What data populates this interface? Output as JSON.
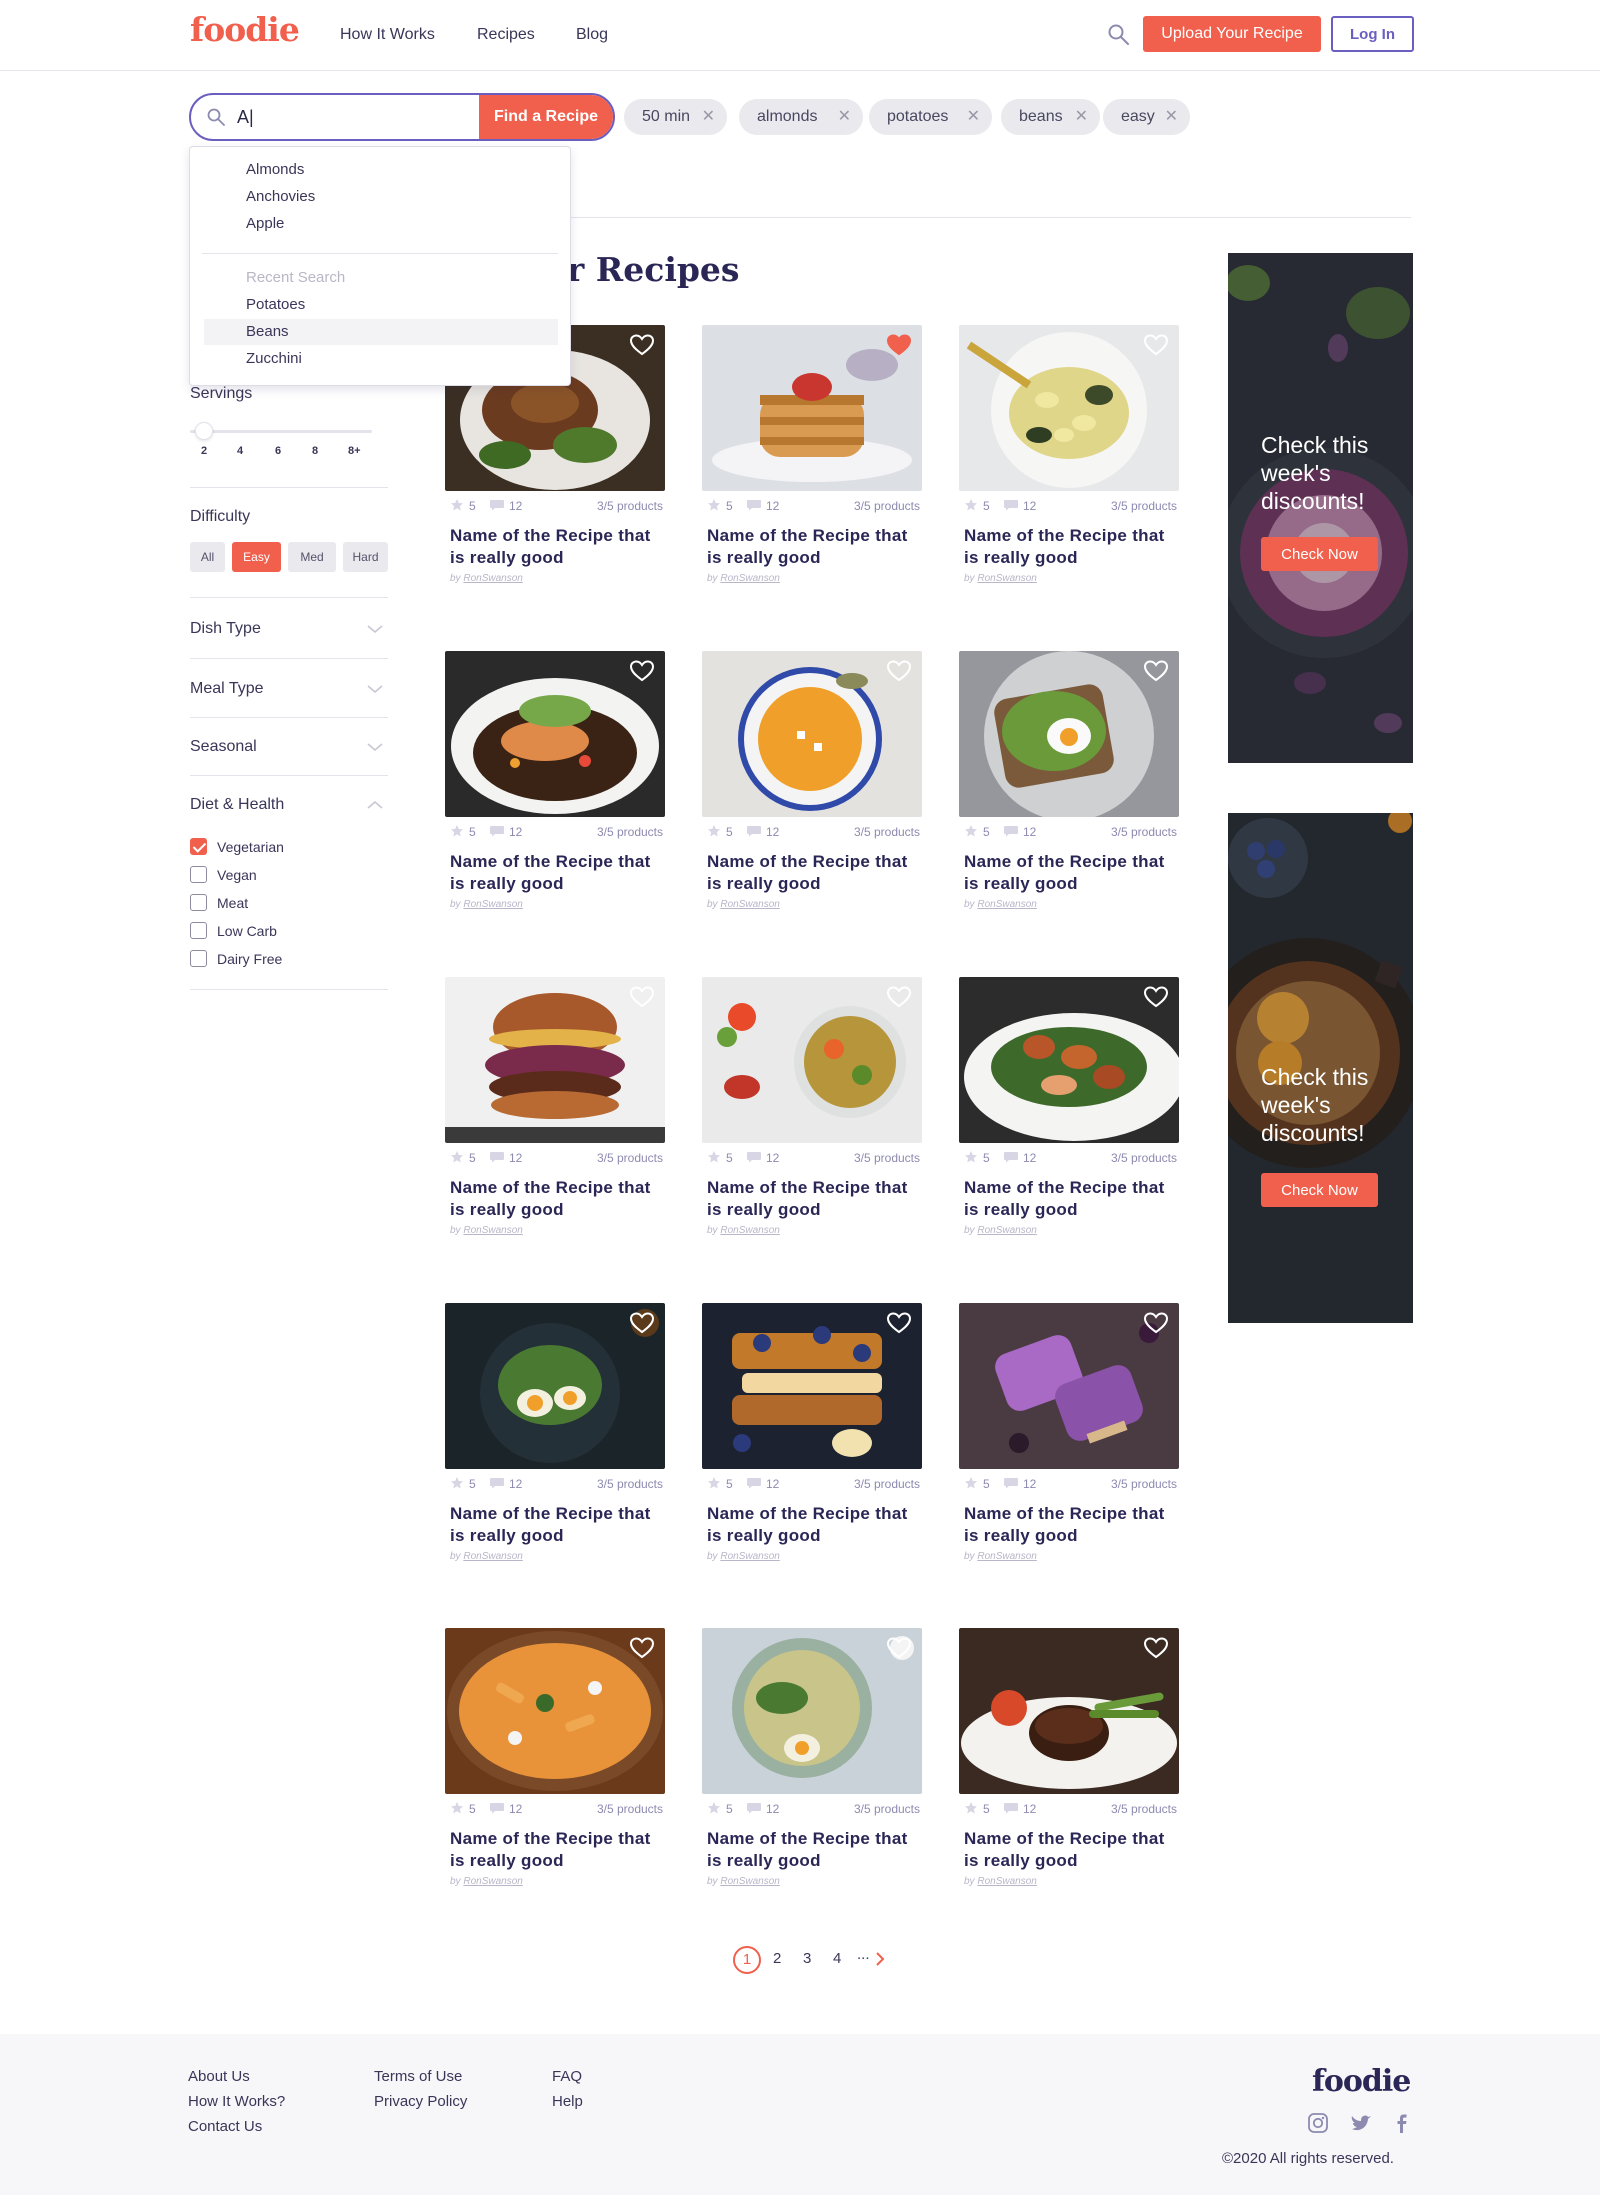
{
  "header": {
    "logo": "foodie",
    "nav": [
      "How It Works",
      "Recipes",
      "Blog"
    ],
    "upload_label": "Upload Your Recipe",
    "login_label": "Log In"
  },
  "search": {
    "value": "A|",
    "button_label": "Find a Recipe",
    "chips": [
      "50 min",
      "almonds",
      "potatoes",
      "beans",
      "easy"
    ]
  },
  "dropdown": {
    "suggestions": [
      "Almonds",
      "Anchovies",
      "Apple"
    ],
    "recent_label": "Recent Search",
    "recent": [
      "Potatoes",
      "Beans",
      "Zucchini"
    ]
  },
  "main": {
    "title": "Popular Recipes"
  },
  "sidebar": {
    "servings_label": "Servings",
    "servings_ticks": [
      "2",
      "4",
      "6",
      "8",
      "8+"
    ],
    "difficulty_label": "Difficulty",
    "difficulty": [
      "All",
      "Easy",
      "Med",
      "Hard"
    ],
    "difficulty_selected": "Easy",
    "accordions": [
      "Dish Type",
      "Meal Type",
      "Seasonal",
      "Diet & Health"
    ],
    "diet_options": [
      {
        "label": "Vegetarian",
        "checked": true
      },
      {
        "label": "Vegan",
        "checked": false
      },
      {
        "label": "Meat",
        "checked": false
      },
      {
        "label": "Low Carb",
        "checked": false
      },
      {
        "label": "Dairy Free",
        "checked": false
      }
    ]
  },
  "card_template": {
    "rating": "5",
    "comments": "12",
    "products": "3/5 products",
    "title": "Name of the Recipe that is really good",
    "by": "by",
    "author": "RonSwanson"
  },
  "recipes": [
    {
      "img": "grilled-meat",
      "fav": false
    },
    {
      "img": "pancakes",
      "fav": true
    },
    {
      "img": "gnocchi",
      "fav": false
    },
    {
      "img": "salmon",
      "fav": false
    },
    {
      "img": "pumpkin-soup",
      "fav": false
    },
    {
      "img": "avocado-toast",
      "fav": false
    },
    {
      "img": "burger",
      "fav": false
    },
    {
      "img": "grain-bowl",
      "fav": false
    },
    {
      "img": "chicken-salad",
      "fav": false
    },
    {
      "img": "egg-salad",
      "fav": false
    },
    {
      "img": "french-toast",
      "fav": false
    },
    {
      "img": "popsicle",
      "fav": false
    },
    {
      "img": "penne",
      "fav": false
    },
    {
      "img": "green-bowl",
      "fav": false
    },
    {
      "img": "steak",
      "fav": false
    }
  ],
  "ads": [
    {
      "text": "Check this week's discounts!",
      "button": "Check Now"
    },
    {
      "text": "Check this week's discounts!",
      "button": "Check Now"
    }
  ],
  "pagination": {
    "pages": [
      "1",
      "2",
      "3",
      "4",
      "..."
    ],
    "current": "1"
  },
  "footer": {
    "col1": [
      "About Us",
      "How It Works?",
      "Contact Us"
    ],
    "col2": [
      "Terms of Use",
      "Privacy Policy"
    ],
    "col3": [
      "FAQ",
      "Help"
    ],
    "logo": "foodie",
    "social": [
      "instagram-icon",
      "twitter-icon",
      "facebook-icon"
    ],
    "copyright": "©2020  All rights reserved."
  },
  "colors": {
    "accent": "#f0604d",
    "brand": "#6a5fc1",
    "ink": "#2a2656"
  }
}
